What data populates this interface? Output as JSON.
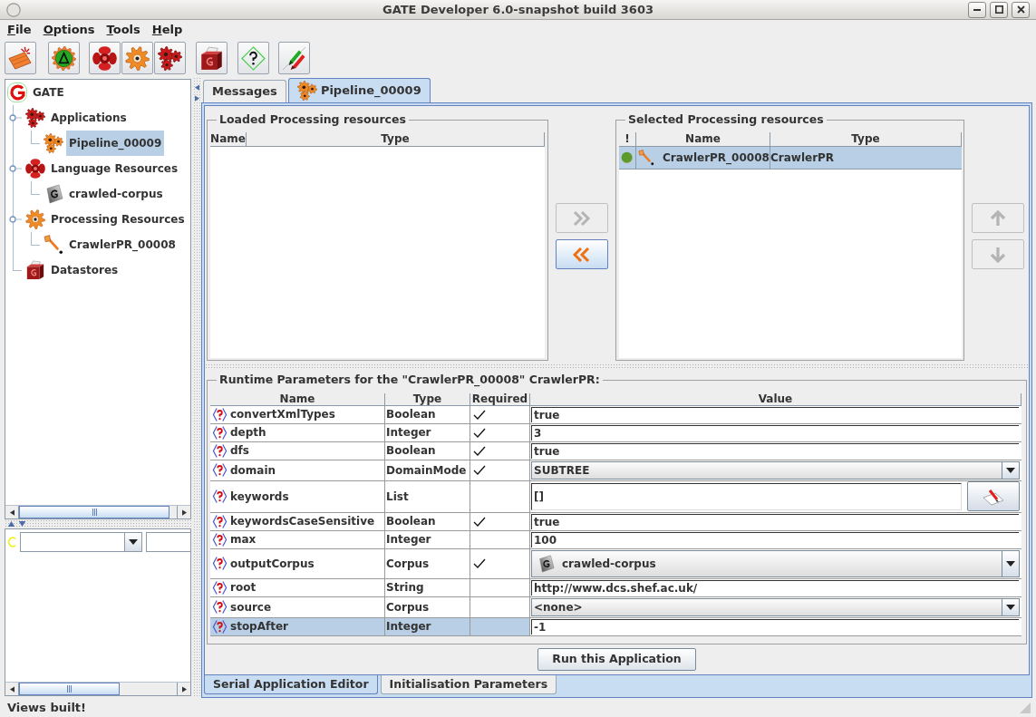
{
  "window": {
    "title": "GATE Developer 6.0-snapshot build 3603"
  },
  "menu": [
    {
      "label": "File"
    },
    {
      "label": "Options"
    },
    {
      "label": "Tools"
    },
    {
      "label": "Help"
    }
  ],
  "tree": {
    "label": "GATE",
    "kind": "gate",
    "selected": false,
    "children": [
      {
        "label": "Applications",
        "kind": "applications",
        "selected": false,
        "expanded": true,
        "children": [
          {
            "label": "Pipeline_00009",
            "kind": "pipeline",
            "selected": true
          }
        ]
      },
      {
        "label": "Language Resources",
        "kind": "language_resources",
        "selected": false,
        "expanded": true,
        "children": [
          {
            "label": "crawled-corpus",
            "kind": "corpus",
            "selected": false
          }
        ]
      },
      {
        "label": "Processing Resources",
        "kind": "processing_resources",
        "selected": false,
        "expanded": true,
        "children": [
          {
            "label": "CrawlerPR_00008",
            "kind": "crawler",
            "selected": false
          }
        ]
      },
      {
        "label": "Datastores",
        "kind": "datastores",
        "selected": false
      }
    ]
  },
  "tabs": [
    {
      "label": "Messages",
      "kind": "plain",
      "selected": false
    },
    {
      "label": "Pipeline_00009",
      "kind": "pipeline",
      "selected": true
    }
  ],
  "loaded_resources": {
    "title": "Loaded Processing resources",
    "columns": [
      "Name",
      "Type"
    ]
  },
  "transfer_buttons": [
    {
      "kind": "add",
      "disabled": true
    },
    {
      "kind": "remove",
      "disabled": false
    }
  ],
  "selected_resources": {
    "title": "Selected Processing resources",
    "columns": [
      "!",
      "Name",
      "Type"
    ],
    "rows": [
      {
        "kind": "crawler",
        "name": "CrawlerPR_00008",
        "type": "CrawlerPR",
        "selected": true
      }
    ]
  },
  "order_buttons": [
    {
      "kind": "up",
      "disabled": true
    },
    {
      "kind": "down",
      "disabled": true
    }
  ],
  "runtime_parameters": {
    "title": "Runtime Parameters for the \"CrawlerPR_00008\" CrawlerPR:",
    "columns": [
      "Name",
      "Type",
      "Required",
      "Value"
    ],
    "rows": [
      {
        "name": "convertXmlTypes",
        "type": "Boolean",
        "required": true,
        "kind": "text",
        "value": "true",
        "selected": false
      },
      {
        "name": "depth",
        "type": "Integer",
        "required": true,
        "kind": "text",
        "value": "3",
        "selected": false
      },
      {
        "name": "dfs",
        "type": "Boolean",
        "required": true,
        "kind": "text",
        "value": "true",
        "selected": false
      },
      {
        "name": "domain",
        "type": "DomainMode",
        "required": true,
        "kind": "dropdown",
        "value": "SUBTREE",
        "selected": false
      },
      {
        "name": "keywords",
        "type": "List",
        "required": false,
        "kind": "list",
        "value": "[]",
        "selected": false
      },
      {
        "name": "keywordsCaseSensitive",
        "type": "Boolean",
        "required": true,
        "kind": "text",
        "value": "true",
        "selected": false
      },
      {
        "name": "max",
        "type": "Integer",
        "required": false,
        "kind": "text",
        "value": "100",
        "selected": false
      },
      {
        "name": "outputCorpus",
        "type": "Corpus",
        "required": true,
        "kind": "corpus",
        "value": "crawled-corpus",
        "selected": false
      },
      {
        "name": "root",
        "type": "String",
        "required": false,
        "kind": "text",
        "value": "http://www.dcs.shef.ac.uk/",
        "selected": false
      },
      {
        "name": "source",
        "type": "Corpus",
        "required": false,
        "kind": "dropdown",
        "value": "<none>",
        "selected": false
      },
      {
        "name": "stopAfter",
        "type": "Integer",
        "required": false,
        "kind": "text",
        "value": "-1",
        "selected": true
      }
    ]
  },
  "run_button": {
    "label": "Run this Application"
  },
  "editor_tabs": [
    {
      "label": "Serial Application Editor",
      "selected": true
    },
    {
      "label": "Initialisation Parameters",
      "selected": false
    }
  ],
  "status_bar": {
    "text": "Views built!"
  }
}
